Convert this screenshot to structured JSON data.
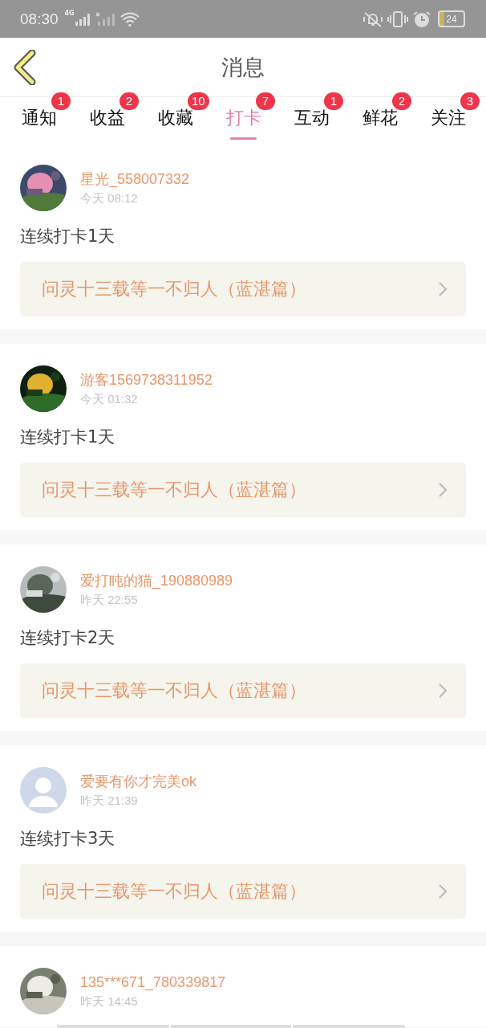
{
  "status_bar": {
    "time": "08:30",
    "signal_label": "4G",
    "battery": "24"
  },
  "header": {
    "title": "消息"
  },
  "tabs": [
    {
      "label": "通知",
      "badge": "1",
      "selected": false
    },
    {
      "label": "收益",
      "badge": "2",
      "selected": false
    },
    {
      "label": "收藏",
      "badge": "10",
      "selected": false
    },
    {
      "label": "打卡",
      "badge": "7",
      "selected": true
    },
    {
      "label": "互动",
      "badge": "1",
      "selected": false
    },
    {
      "label": "鲜花",
      "badge": "2",
      "selected": false
    },
    {
      "label": "关注",
      "badge": "3",
      "selected": false
    }
  ],
  "messages": [
    {
      "kind": "picture",
      "user": "星光_558007332",
      "time": "今天 08:12",
      "text": "连续打卡1天",
      "book": "问灵十三载等一不归人（蓝湛篇）"
    },
    {
      "kind": "picture",
      "user": "游客1569738311952",
      "time": "今天 01:32",
      "text": "连续打卡1天",
      "book": "问灵十三载等一不归人（蓝湛篇）"
    },
    {
      "kind": "picture",
      "user": "爱打盹的猫_190880989",
      "time": "昨天 22:55",
      "text": "连续打卡2天",
      "book": "问灵十三载等一不归人（蓝湛篇）"
    },
    {
      "kind": "placeholder",
      "user": "爱要有你才完美ok",
      "time": "昨天 21:39",
      "text": "连续打卡3天",
      "book": "问灵十三载等一不归人（蓝湛篇）"
    },
    {
      "kind": "picture",
      "user": "135***671_780339817",
      "time": "昨天 14:45"
    }
  ]
}
